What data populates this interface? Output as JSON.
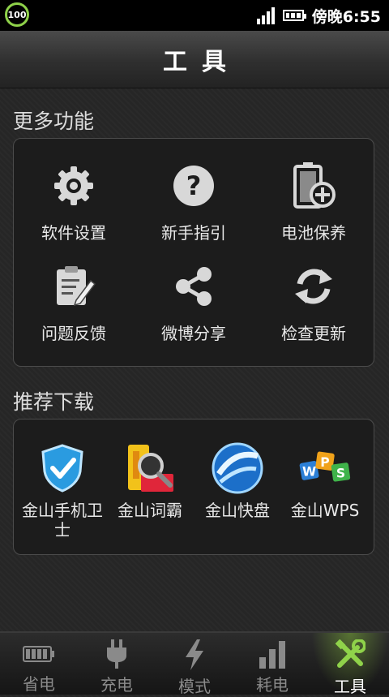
{
  "status_bar": {
    "battery_level": "100",
    "time": "傍晚6:55"
  },
  "title": "工具",
  "sections": {
    "more_features": {
      "title": "更多功能",
      "items": [
        {
          "label": "软件设置",
          "icon": "gear-icon"
        },
        {
          "label": "新手指引",
          "icon": "help-icon"
        },
        {
          "label": "电池保养",
          "icon": "battery-plus-icon"
        },
        {
          "label": "问题反馈",
          "icon": "clipboard-edit-icon"
        },
        {
          "label": "微博分享",
          "icon": "share-icon"
        },
        {
          "label": "检查更新",
          "icon": "refresh-icon"
        }
      ]
    },
    "recommended": {
      "title": "推荐下载",
      "items": [
        {
          "label": "金山手机卫士",
          "icon": "shield-check-icon"
        },
        {
          "label": "金山词霸",
          "icon": "dictionary-icon"
        },
        {
          "label": "金山快盘",
          "icon": "cloud-disk-icon"
        },
        {
          "label": "金山WPS",
          "icon": "wps-icon"
        }
      ]
    }
  },
  "tabs": [
    {
      "label": "省电",
      "icon": "battery-icon",
      "active": false
    },
    {
      "label": "充电",
      "icon": "plug-icon",
      "active": false
    },
    {
      "label": "模式",
      "icon": "lightning-icon",
      "active": false
    },
    {
      "label": "耗电",
      "icon": "bars-icon",
      "active": false
    },
    {
      "label": "工具",
      "icon": "tools-icon",
      "active": true
    }
  ],
  "colors": {
    "accent": "#8fd24a"
  }
}
